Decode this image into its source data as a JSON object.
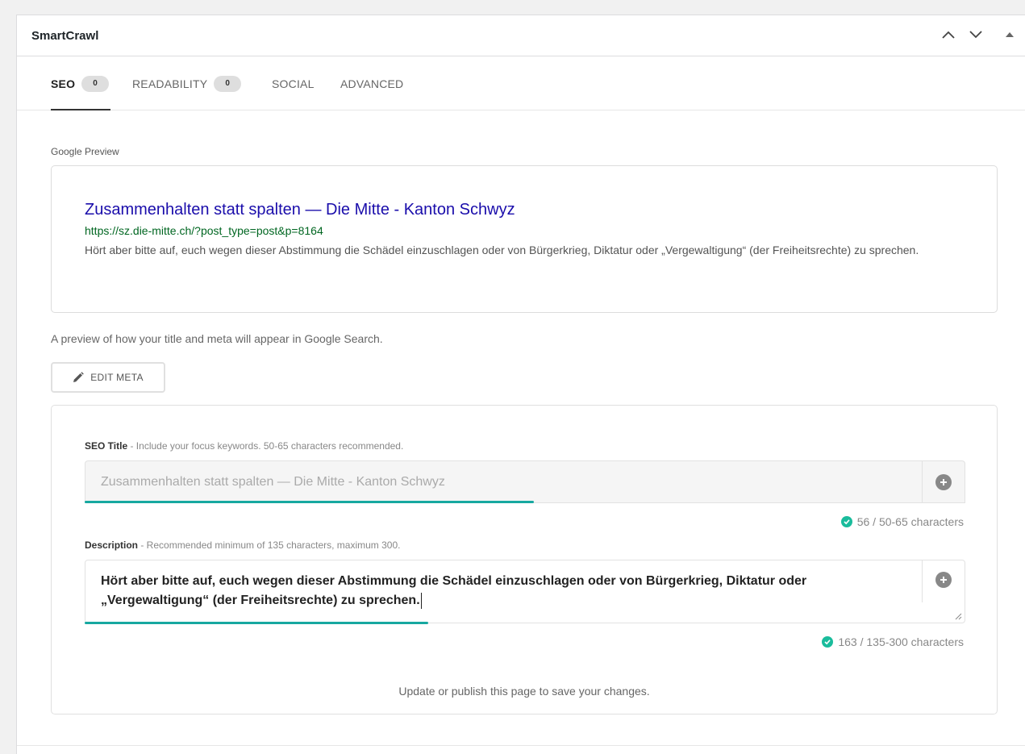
{
  "metabox": {
    "title": "SmartCrawl"
  },
  "tabs": [
    {
      "label": "SEO",
      "count": "0"
    },
    {
      "label": "READABILITY",
      "count": "0"
    },
    {
      "label": "SOCIAL"
    },
    {
      "label": "ADVANCED"
    }
  ],
  "google_preview": {
    "label": "Google Preview",
    "title": "Zusammenhalten statt spalten — Die Mitte - Kanton Schwyz",
    "url": "https://sz.die-mitte.ch/?post_type=post&p=8164",
    "description": "Hört aber bitte auf, euch wegen dieser Abstimmung die Schädel einzuschlagen oder von Bürgerkrieg, Diktatur oder „Vergewaltigung“ (der Freiheitsrechte) zu sprechen.",
    "hint": "A preview of how your title and meta will appear in Google Search."
  },
  "edit_meta": {
    "label": "EDIT META"
  },
  "seo_title": {
    "label": "SEO Title",
    "help": " - Include your focus keywords. 50-65 characters recommended.",
    "placeholder": "Zusammenhalten statt spalten — Die Mitte - Kanton Schwyz",
    "counter": "56 / 50-65 characters",
    "progress": 0.51
  },
  "description": {
    "label": "Description",
    "help": " - Recommended minimum of 135 characters, maximum 300.",
    "value": "Hört aber bitte auf, euch wegen dieser Abstimmung die Schädel einzuschlagen oder von Bürgerkrieg, Diktatur oder „Vergewaltigung“ (der Freiheitsrechte) zu sprechen.",
    "counter": "163 / 135-300 characters",
    "progress": 0.39
  },
  "save_note": "Update or publish this page to save your changes.",
  "colors": {
    "link_title": "#1a0dab",
    "link_url": "#006621",
    "accent": "#17a8a0",
    "success": "#1abc9c"
  },
  "icons": {
    "collapse_up": "chevron-up-icon",
    "collapse_down": "chevron-down-icon",
    "toggle": "triangle-up-icon",
    "edit": "pencil-icon",
    "insert_variable": "plus-circle-icon",
    "valid": "check-circle-icon"
  }
}
